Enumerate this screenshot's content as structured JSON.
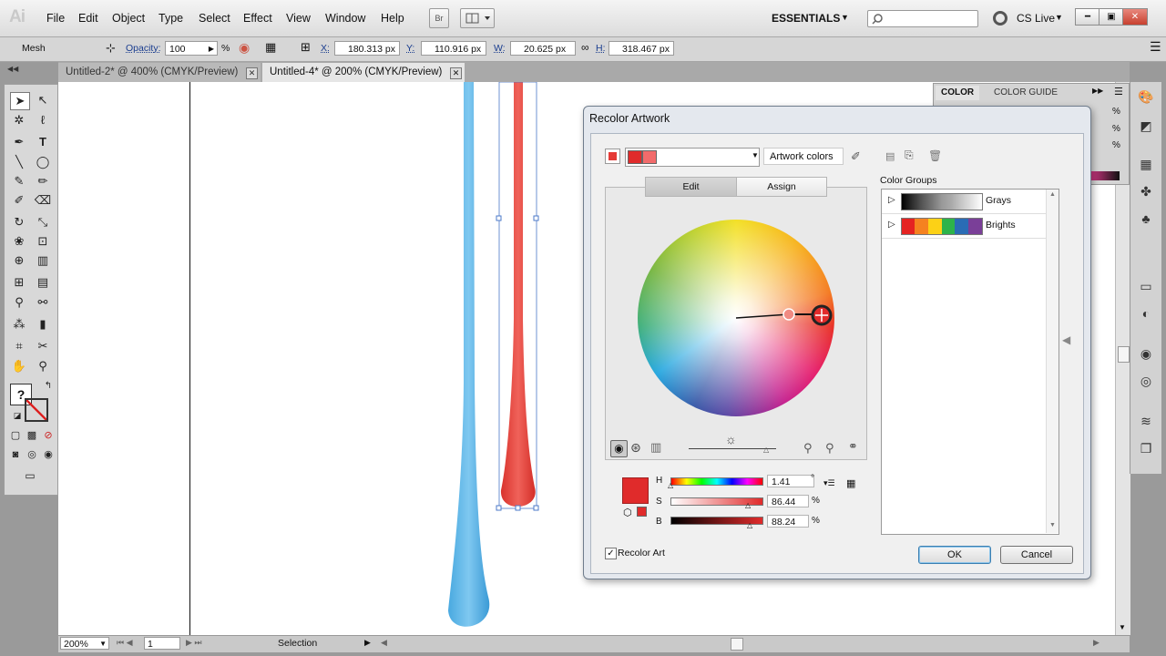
{
  "app": {
    "logo": "Ai"
  },
  "menu": [
    "File",
    "Edit",
    "Object",
    "Type",
    "Select",
    "Effect",
    "View",
    "Window",
    "Help"
  ],
  "bridge_label": "Br",
  "workspace": "ESSENTIALS",
  "cs_live": "CS Live",
  "control_bar": {
    "selection_type": "Mesh",
    "opacity_label": "Opacity:",
    "opacity_value": "100",
    "opacity_unit": "%",
    "x_label": "X:",
    "x_value": "180.313 px",
    "y_label": "Y:",
    "y_value": "110.916 px",
    "w_label": "W:",
    "w_value": "20.625 px",
    "h_label": "H:",
    "h_value": "318.467 px"
  },
  "tabs": [
    {
      "label": "Untitled-2* @ 400% (CMYK/Preview)"
    },
    {
      "label": "Untitled-4* @ 200% (CMYK/Preview)"
    }
  ],
  "status": {
    "zoom": "200%",
    "page": "1",
    "tool": "Selection"
  },
  "color_panel": {
    "tab_color": "COLOR",
    "tab_color_guide": "COLOR GUIDE",
    "percent": "%"
  },
  "dialog": {
    "title": "Recolor Artwork",
    "artwork_colors_label": "Artwork colors",
    "tab_edit": "Edit",
    "tab_assign": "Assign",
    "color_groups_label": "Color Groups",
    "groups": [
      {
        "name": "Grays"
      },
      {
        "name": "Brights"
      }
    ],
    "h_label": "H",
    "h_value": "1.41",
    "h_unit": "°",
    "s_label": "S",
    "s_value": "86.44",
    "s_unit": "%",
    "b_label": "B",
    "b_value": "88.24",
    "b_unit": "%",
    "recolor_art_label": "Recolor Art",
    "ok_label": "OK",
    "cancel_label": "Cancel"
  },
  "colors": {
    "accent_red": "#e53a36",
    "blue_drop": "#4fb0e6",
    "selection_blue": "#4b78c8"
  }
}
